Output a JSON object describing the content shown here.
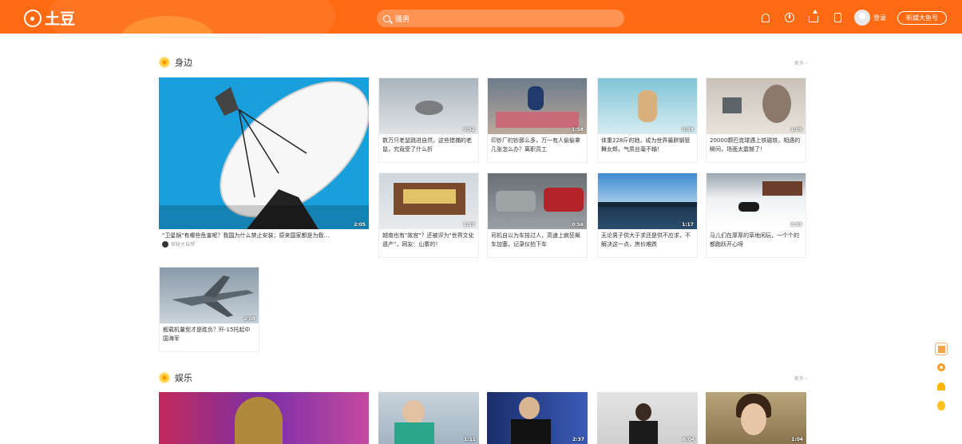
{
  "header": {
    "logo_text": "土豆",
    "search_placeholder": "骚男",
    "login_label": "登录",
    "creator_label": "新媒大鱼号"
  },
  "sections": [
    {
      "title": "身边",
      "more": "更多 ›",
      "featured": {
        "duration": "2:05",
        "caption": "\"卫星锅\"有哪些危害呢？我国为什么禁止安装；原来国家都是为我…",
        "source": "探秘大自然"
      },
      "cards": [
        {
          "duration": "0:52",
          "caption": "数万只老鼠跳进自然，这些猎捕的老鼠，究竟受了什么折"
        },
        {
          "duration": "1:58",
          "caption": "印钞厂的钞那么多，万一有人偷偷拿几张怎么办？离职员工"
        },
        {
          "duration": "0:59",
          "caption": "体重228斤的她，成为世界最胖钢管舞女郎，气质丝毫不输！"
        },
        {
          "duration": "1:05",
          "caption": "20000颗巴克球遇上铁磁铁，相遇的瞬间，场面太震撼了！"
        },
        {
          "duration": "1:37",
          "caption": "越南也有\"故宫\"？还被评为\"世界文化遗产\"，网友：山寨的！"
        },
        {
          "duration": "0:56",
          "caption": "司机自以为车技过人，高速上疯狂飙车加塞，记录仪拍下车"
        },
        {
          "duration": "1:17",
          "caption": "无论男子供大于求还是供不应求，不解决这一点，房价难跌"
        },
        {
          "duration": "2:59",
          "caption": "马儿们在厚厚的草地闲玩，一个个的都跑跃开心呀"
        },
        {
          "duration": "2:08",
          "caption": "舰载机量型才是胜负？歼-15托起中国海军"
        }
      ]
    },
    {
      "title": "娱乐",
      "more": "更多 ›",
      "featured": {
        "duration": ""
      },
      "cards": [
        {
          "duration": "1:11"
        },
        {
          "duration": "2:37"
        },
        {
          "duration": "6:04"
        },
        {
          "duration": "1:04"
        }
      ]
    }
  ],
  "icons": {
    "notification": "bell-icon",
    "history": "clock-icon",
    "upload": "upload-icon",
    "app": "phone-icon"
  }
}
